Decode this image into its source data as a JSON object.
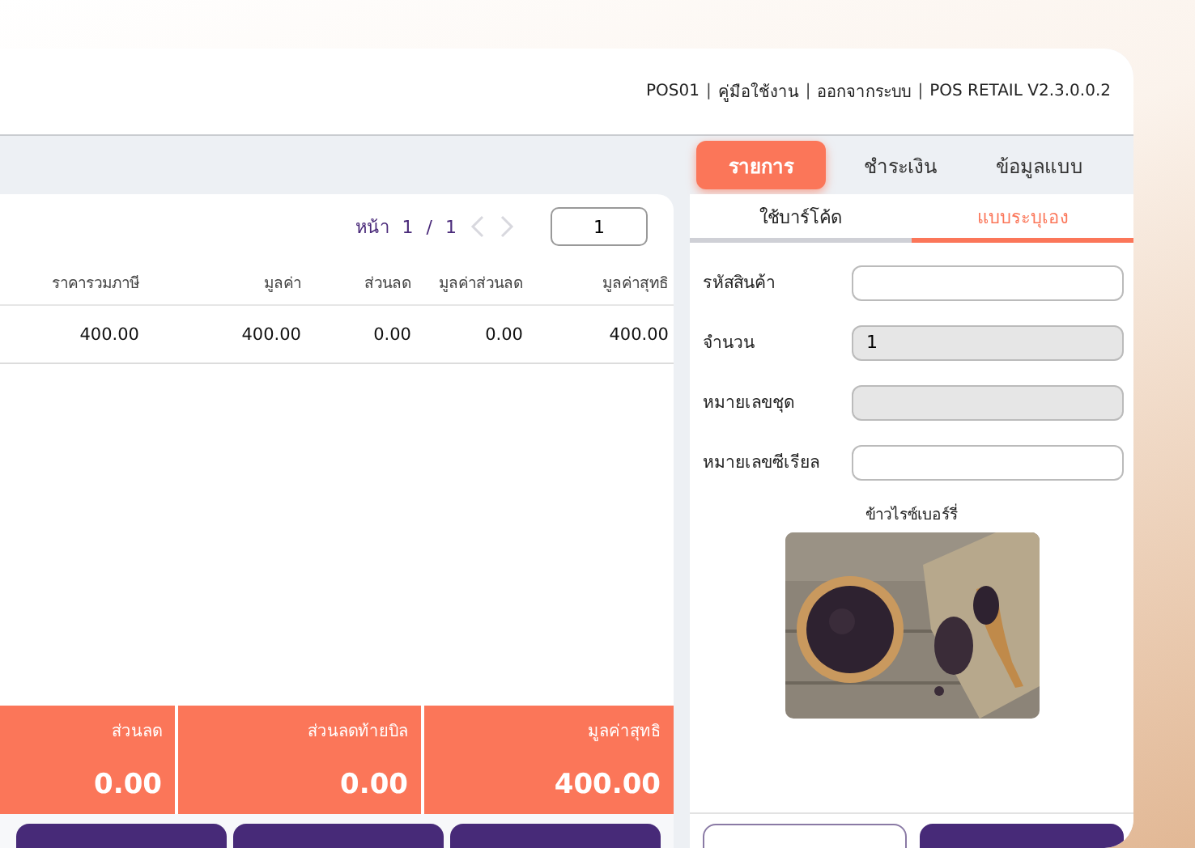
{
  "header": {
    "items": [
      {
        "kind": "text",
        "text": "POS01"
      },
      {
        "kind": "sep",
        "text": "|"
      },
      {
        "kind": "link",
        "text": "คู่มือใช้งาน"
      },
      {
        "kind": "sep",
        "text": "|"
      },
      {
        "kind": "link",
        "text": "ออกจากระบบ"
      },
      {
        "kind": "sep",
        "text": "|"
      },
      {
        "kind": "text",
        "text": "POS RETAIL V2.3.0.0.2"
      }
    ]
  },
  "tabs": [
    {
      "label": "รายการ",
      "selected": true
    },
    {
      "label": "ชำระเงิน",
      "selected": false
    },
    {
      "label": "ข้อมูลแบบ",
      "selected": false
    }
  ],
  "pager": {
    "label": "หน้า",
    "current": "1",
    "separator": "/",
    "total": "1",
    "page_input": "1"
  },
  "table": {
    "columns": [
      "ราคารวมภาษี",
      "มูลค่า",
      "ส่วนลด",
      "มูลค่าส่วนลด",
      "มูลค่าสุทธิ"
    ],
    "rows": [
      [
        "400.00",
        "400.00",
        "0.00",
        "0.00",
        "400.00"
      ]
    ]
  },
  "summary": [
    {
      "label": "ส่วนลด",
      "value": "0.00"
    },
    {
      "label": "ส่วนลดท้ายบิล",
      "value": "0.00"
    },
    {
      "label": "มูลค่าสุทธิ",
      "value": "400.00"
    }
  ],
  "entry_tabs": [
    {
      "label": "ใช้บาร์โค้ด",
      "selected": false
    },
    {
      "label": "แบบระบุเอง",
      "selected": true
    }
  ],
  "fields": [
    {
      "label": "รหัสสินค้า",
      "disabled": false
    },
    {
      "label": "จำนวน",
      "value": "1",
      "disabled": true
    },
    {
      "label": "หมายเลขชุด",
      "disabled": true
    },
    {
      "label": "หมายเลขซีเรียล",
      "disabled": false
    }
  ],
  "product": {
    "name": "ข้าวไรซ์เบอร์รี่"
  },
  "bottom_buttons": [
    {
      "kind": "filled"
    },
    {
      "kind": "filled"
    },
    {
      "kind": "filled"
    }
  ],
  "side_buttons": [
    {
      "kind": "outline"
    },
    {
      "kind": "filled"
    }
  ]
}
